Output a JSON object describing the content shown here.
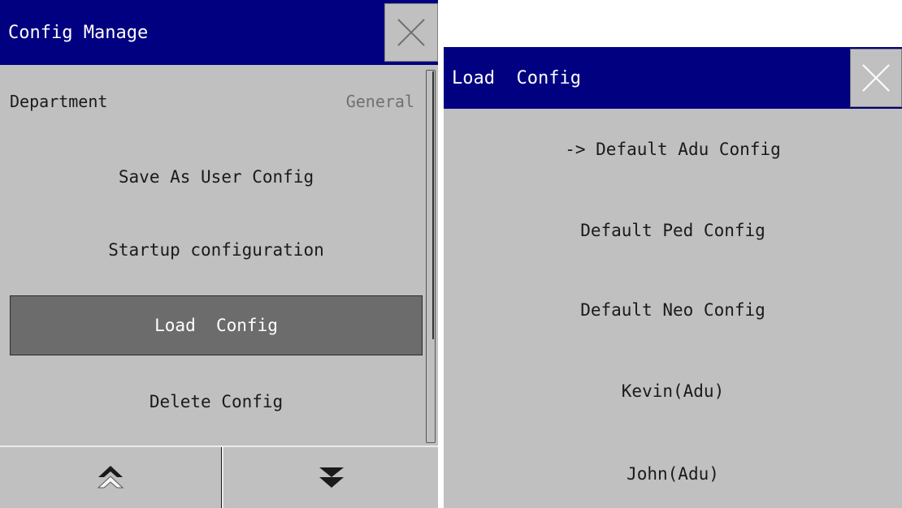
{
  "config_manage": {
    "title": "Config Manage",
    "department": {
      "label": "Department",
      "value": "General"
    },
    "items": [
      {
        "label": "Save As User Config",
        "selected": false
      },
      {
        "label": "Startup configuration",
        "selected": false
      },
      {
        "label": "Load  Config",
        "selected": true
      },
      {
        "label": "Delete Config",
        "selected": false
      }
    ],
    "footer": {
      "up_icon": "double-chevron-up-icon",
      "down_icon": "double-chevron-down-icon"
    },
    "close_icon": "close-icon"
  },
  "load_config": {
    "title": "Load  Config",
    "items": [
      {
        "label": "-> Default Adu Config"
      },
      {
        "label": "Default Ped Config"
      },
      {
        "label": "Default Neo Config"
      },
      {
        "label": "Kevin(Adu)"
      },
      {
        "label": "John(Adu)"
      }
    ],
    "close_icon": "close-icon"
  },
  "colors": {
    "titlebar": "#000080",
    "panel_bg": "#c0c0c0",
    "selected_bg": "#6c6c6c"
  }
}
